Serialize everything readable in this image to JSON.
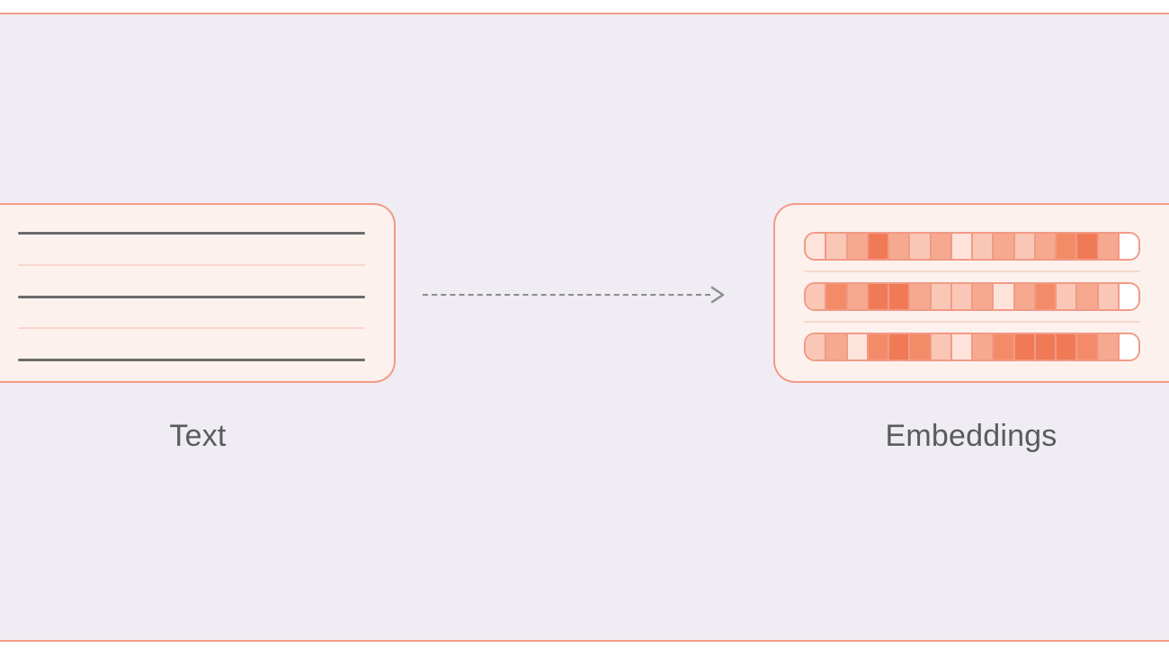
{
  "labels": {
    "left": "Text",
    "right": "Embeddings"
  },
  "embedding_rows": [
    [
      1,
      2,
      3,
      5,
      3,
      2,
      3,
      1,
      2,
      3,
      2,
      3,
      4,
      5,
      3,
      0
    ],
    [
      2,
      4,
      3,
      5,
      5,
      3,
      2,
      2,
      3,
      1,
      3,
      4,
      2,
      3,
      2,
      0
    ],
    [
      2,
      3,
      1,
      4,
      5,
      4,
      2,
      1,
      3,
      4,
      5,
      5,
      5,
      4,
      3,
      0
    ]
  ],
  "shade_classes": [
    "s0",
    "s1",
    "s2",
    "s3",
    "s4",
    "s5"
  ]
}
